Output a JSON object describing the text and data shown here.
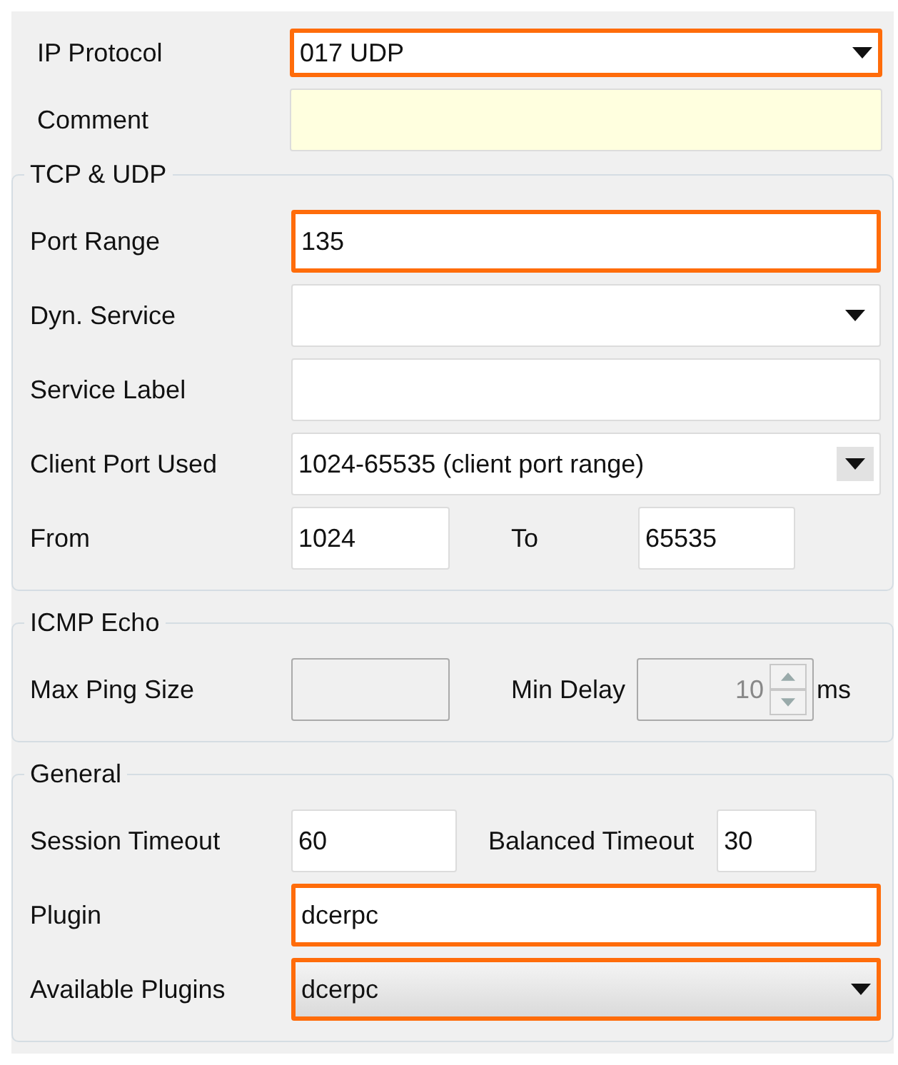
{
  "top_fields": [
    {
      "label": "IP Protocol",
      "kind": "select",
      "value": "017 UDP",
      "highlighted": true
    },
    {
      "label": "Comment",
      "kind": "memo",
      "highlighted": false
    }
  ],
  "groups": [
    {
      "title": "TCP & UDP",
      "rows": [
        [
          {
            "label": "Port Range",
            "kind": "text",
            "value": "135",
            "highlighted": true
          }
        ],
        [
          {
            "label": "Dyn. Service",
            "kind": "select",
            "highlighted": false
          }
        ],
        [
          {
            "label": "Service Label",
            "kind": "text",
            "highlighted": false
          }
        ],
        [
          {
            "label": "Client Port Used",
            "kind": "select",
            "value": "1024-65535 (client port range)",
            "highlighted": false
          }
        ],
        [
          {
            "label": "From",
            "kind": "text",
            "value": "1024",
            "highlighted": false
          },
          {
            "label": "To",
            "kind": "text",
            "value": "65535",
            "highlighted": false
          }
        ]
      ]
    },
    {
      "title": "ICMP Echo",
      "rows": [
        [
          {
            "label": "Max Ping Size",
            "kind": "text",
            "disabled": true,
            "highlighted": false
          },
          {
            "label": "Min Delay",
            "kind": "spin",
            "value": "10",
            "unit": "ms",
            "disabled": true,
            "highlighted": false
          }
        ]
      ]
    },
    {
      "title": "General",
      "rows": [
        [
          {
            "label": "Session Timeout",
            "kind": "text",
            "value": "60",
            "highlighted": false
          },
          {
            "label": "Balanced Timeout",
            "kind": "text",
            "value": "30",
            "highlighted": false
          }
        ],
        [
          {
            "label": "Plugin",
            "kind": "text",
            "value": "dcerpc",
            "highlighted": true
          }
        ],
        [
          {
            "label": "Available Plugins",
            "kind": "droplist",
            "value": "dcerpc",
            "highlighted": true
          }
        ]
      ]
    }
  ]
}
